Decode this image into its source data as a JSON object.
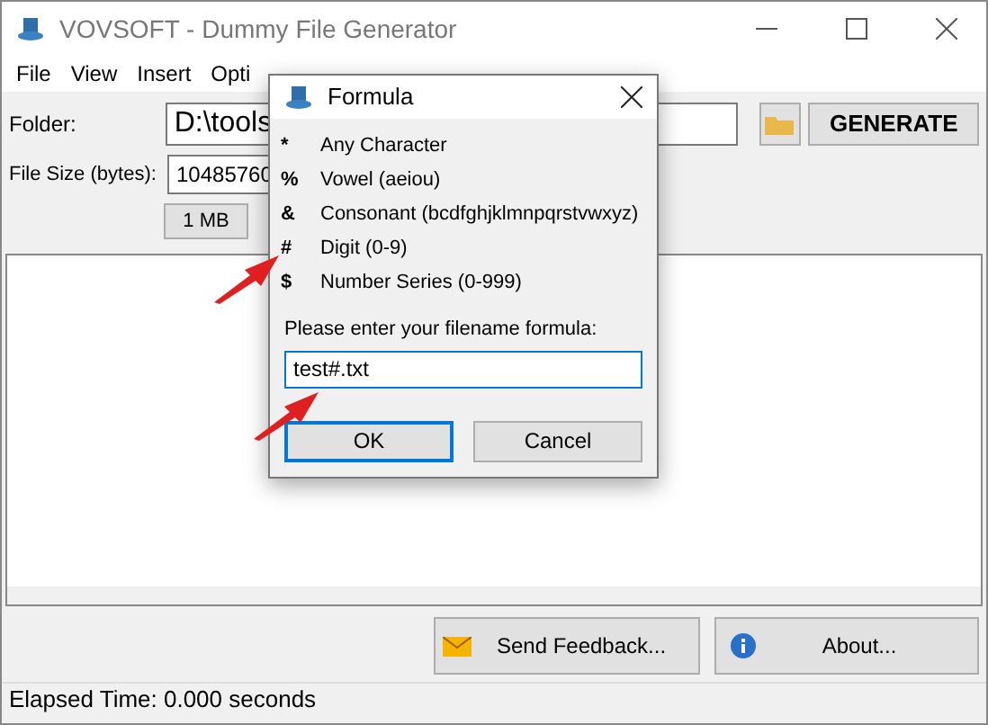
{
  "window": {
    "title": "VOVSOFT - Dummy File Generator"
  },
  "menu": [
    "File",
    "View",
    "Insert",
    "Opti"
  ],
  "folder": {
    "label": "Folder:",
    "value": "D:\\tools"
  },
  "generate_button": "GENERATE",
  "file_size": {
    "label": "File Size (bytes):",
    "value": "10485760"
  },
  "size_button": "1 MB",
  "footer_buttons": [
    "Send Feedback...",
    "About..."
  ],
  "status_bar": "Elapsed Time: 0.000 seconds",
  "dialog": {
    "title": "Formula",
    "rules": [
      {
        "symbol": "*",
        "meaning": "Any Character"
      },
      {
        "symbol": "%",
        "meaning": "Vowel (aeiou)"
      },
      {
        "symbol": "&",
        "meaning": "Consonant (bcdfghjklmnpqrstvwxyz)"
      },
      {
        "symbol": "#",
        "meaning": "Digit (0-9)"
      },
      {
        "symbol": "$",
        "meaning": "Number Series (0-999)"
      }
    ],
    "prompt": "Please enter your filename formula:",
    "value": "test#.txt",
    "buttons": [
      {
        "label": "OK",
        "selected": true
      },
      {
        "label": "Cancel",
        "selected": false
      }
    ]
  }
}
